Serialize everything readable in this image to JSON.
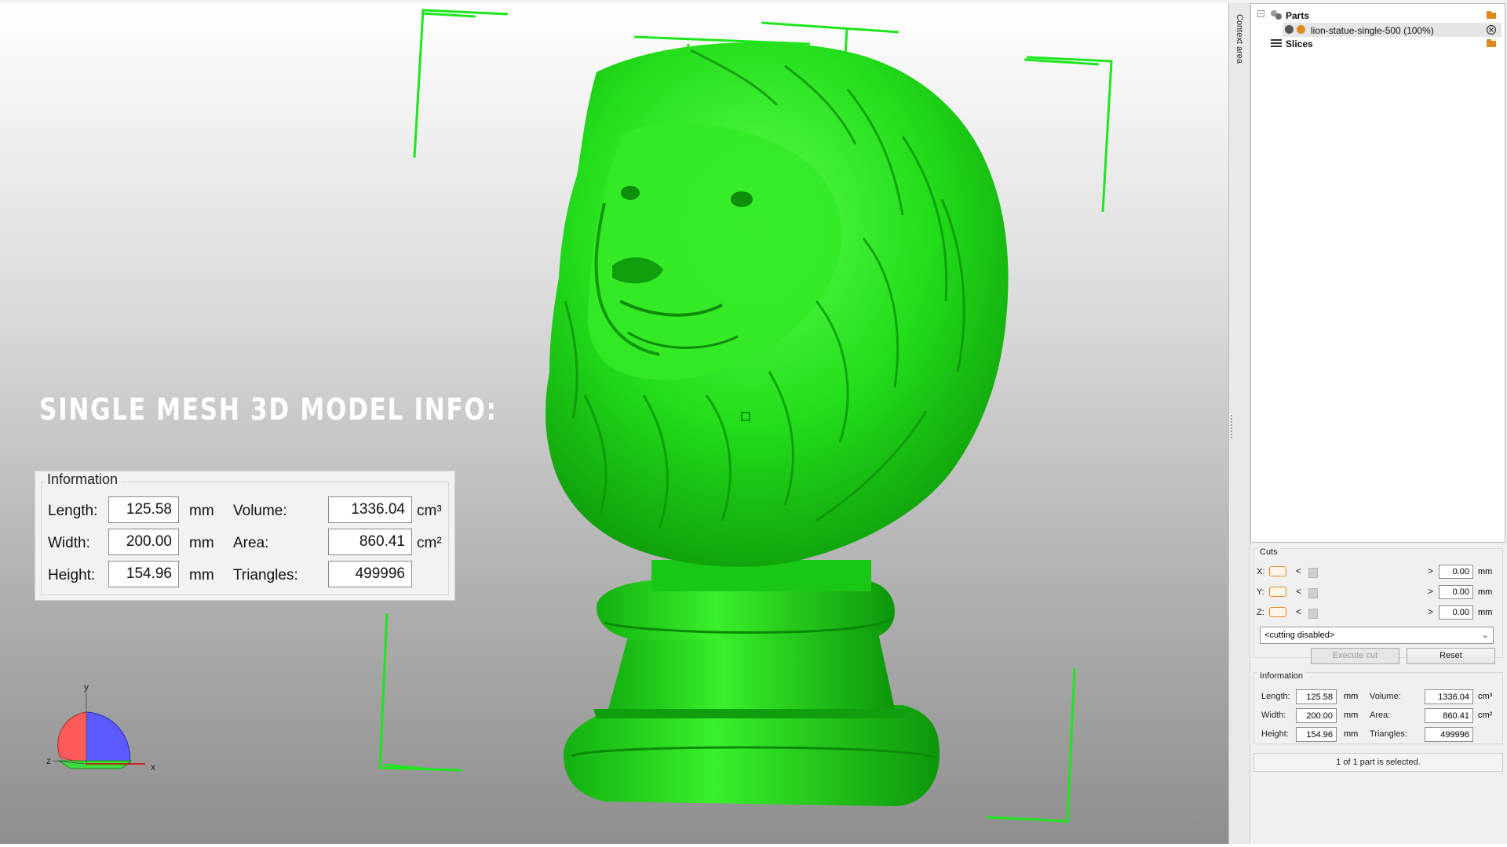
{
  "viewport": {
    "overlay_title": "SINGLE MESH 3D MODEL INFO:",
    "info": {
      "legend": "Information",
      "length_label": "Length:",
      "length_value": "125.58",
      "length_unit": "mm",
      "width_label": "Width:",
      "width_value": "200.00",
      "width_unit": "mm",
      "height_label": "Height:",
      "height_value": "154.96",
      "height_unit": "mm",
      "volume_label": "Volume:",
      "volume_value": "1336.04",
      "volume_unit": "cm³",
      "area_label": "Area:",
      "area_value": "860.41",
      "area_unit": "cm²",
      "triangles_label": "Triangles:",
      "triangles_value": "499996"
    },
    "axis": {
      "y": "y",
      "z": "z",
      "x": "x"
    },
    "model_color": "#22dd1a"
  },
  "splitter": {
    "label": "Context area"
  },
  "tree": {
    "parts_label": "Parts",
    "part_item_label": "lion-statue-single-500 (100%)",
    "slices_label": "Slices",
    "expander_symbol": "−"
  },
  "cuts": {
    "legend": "Cuts",
    "rows": [
      {
        "axis": "X:",
        "value": "0.00",
        "unit": "mm"
      },
      {
        "axis": "Y:",
        "value": "0.00",
        "unit": "mm"
      },
      {
        "axis": "Z:",
        "value": "0.00",
        "unit": "mm"
      }
    ],
    "left_arrow": "<",
    "right_arrow": ">",
    "mode_select": "<cutting disabled>",
    "execute_label": "Execute cut",
    "reset_label": "Reset"
  },
  "info_panel": {
    "legend": "Information",
    "length_label": "Length:",
    "length_value": "125.58",
    "length_unit": "mm",
    "width_label": "Width:",
    "width_value": "200.00",
    "width_unit": "mm",
    "height_label": "Height:",
    "height_value": "154.96",
    "height_unit": "mm",
    "volume_label": "Volume:",
    "volume_value": "1336.04",
    "volume_unit": "cm³",
    "area_label": "Area:",
    "area_value": "860.41",
    "area_unit": "cm²",
    "triangles_label": "Triangles:",
    "triangles_value": "499996"
  },
  "status": {
    "text": "1 of 1 part is selected."
  },
  "colors": {
    "accent_orange": "#e08a1e",
    "bbox_green": "#1ee61e"
  }
}
